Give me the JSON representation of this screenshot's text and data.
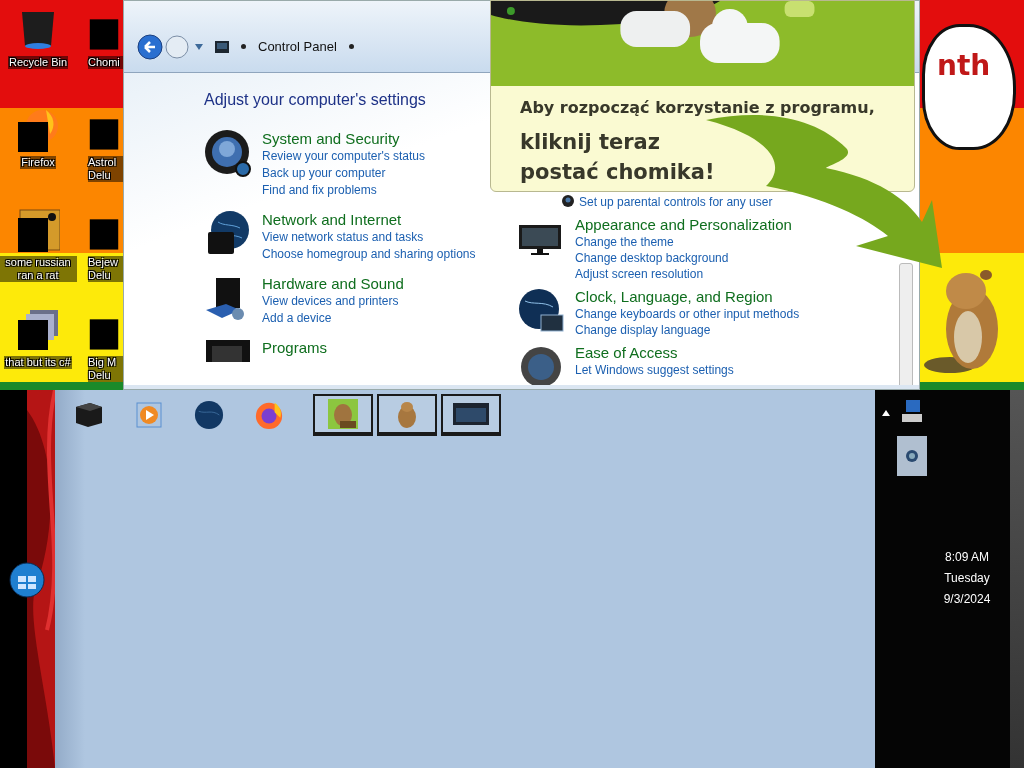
{
  "desktop": {
    "icons": [
      {
        "label": "Recycle Bin",
        "kind": "bin"
      },
      {
        "label": "Firefox",
        "kind": "covered-firefox"
      },
      {
        "label": "some russian ran a rat",
        "kind": "covered-e"
      },
      {
        "label": "that but its c#",
        "kind": "covered-stack"
      }
    ],
    "cut_icons": [
      {
        "label": "Chomi"
      },
      {
        "label": "Astrol Delu"
      },
      {
        "label": "Bejew Delu"
      },
      {
        "label": "Big M Delu"
      }
    ]
  },
  "window": {
    "breadcrumb": "Control Panel",
    "heading": "Adjust your computer's settings",
    "columns": [
      [
        {
          "kind": "shield",
          "title": "System and Security",
          "links": [
            "Review your computer's status",
            "Back up your computer",
            "Find and fix problems"
          ]
        },
        {
          "kind": "globe",
          "title": "Network and Internet",
          "links": [
            "View network status and tasks",
            "Choose homegroup and sharing options"
          ]
        },
        {
          "kind": "printer",
          "title": "Hardware and Sound",
          "links": [
            "View devices and printers",
            "Add a device"
          ]
        },
        {
          "kind": "programs",
          "title": "Programs"
        }
      ],
      [
        {
          "kind": "parental",
          "links": [
            "Set up parental controls for any user"
          ]
        },
        {
          "kind": "monitor",
          "title": "Appearance and Personalization",
          "links": [
            "Change the theme",
            "Change desktop background",
            "Adjust screen resolution"
          ]
        },
        {
          "kind": "clock",
          "title": "Clock, Language, and Region",
          "links": [
            "Change keyboards or other input methods",
            "Change display language"
          ]
        },
        {
          "kind": "ease",
          "title": "Ease of Access",
          "links": [
            "Let Windows suggest settings"
          ]
        }
      ]
    ]
  },
  "popup": {
    "message": "Aby rozpocząć korzystanie z programu,",
    "call_to_action": [
      "kliknij teraz",
      "postać chomika!"
    ]
  },
  "bubble": {
    "text": "nth"
  },
  "taskbar": {
    "items": [
      {
        "kind": "box"
      },
      {
        "kind": "media"
      },
      {
        "kind": "globe"
      },
      {
        "kind": "firefox"
      },
      {
        "kind": "task-hamster-box"
      },
      {
        "kind": "task-hamster"
      },
      {
        "kind": "task-window"
      }
    ]
  },
  "clock": {
    "time": "8:09 AM",
    "day": "Tuesday",
    "date": "9/3/2024"
  }
}
